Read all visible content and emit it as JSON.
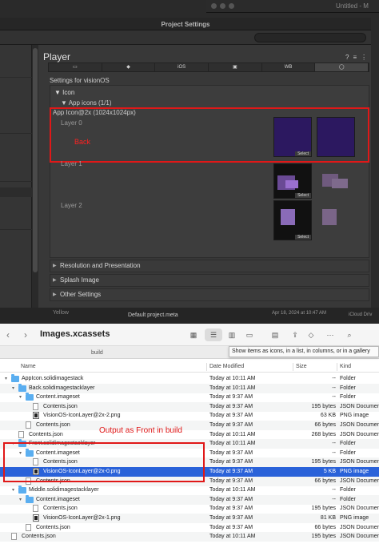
{
  "unity": {
    "bg_window_title": "Untitled - M",
    "window_title": "Project Settings",
    "panel_title": "Player",
    "platform_tabs": [
      "",
      "",
      "iOS",
      "",
      "WB",
      ""
    ],
    "settings_for": "Settings for visionOS",
    "icon_section": "Icon",
    "app_icons": "App icons (1/1)",
    "app_icon_size": "App Icon@2x (1024x1024px)",
    "layers": [
      "Layer 0",
      "Layer 1",
      "Layer 2"
    ],
    "select_label": "Select",
    "back_annotation": "Back",
    "sections": [
      "Resolution and Presentation",
      "Splash Image",
      "Other Settings"
    ],
    "bg_strip": {
      "left": "Yellow",
      "middle": "Default project.meta",
      "date": "Apr 18, 2024 at 10:47 AM",
      "right": "iCloud Driv"
    }
  },
  "finder": {
    "title": "Images.xcassets",
    "path": "build",
    "tooltip": "Show items as icons, in a list, in columns, or in a gallery",
    "columns": {
      "name": "Name",
      "date": "Date Modified",
      "size": "Size",
      "kind": "Kind"
    },
    "annotation": "Output as Front in build",
    "rows": [
      {
        "name": "AppIcon.solidimagestack",
        "date": "Today at 10:11 AM",
        "size": "--",
        "kind": "Folder"
      },
      {
        "name": "Back.solidimagestacklayer",
        "date": "Today at 10:11 AM",
        "size": "--",
        "kind": "Folder"
      },
      {
        "name": "Content.imageset",
        "date": "Today at 9:37 AM",
        "size": "--",
        "kind": "Folder"
      },
      {
        "name": "Contents.json",
        "date": "Today at 9:37 AM",
        "size": "195 bytes",
        "kind": "JSON Document"
      },
      {
        "name": "VisionOS-IconLayer@2x-2.png",
        "date": "Today at 9:37 AM",
        "size": "63 KB",
        "kind": "PNG image"
      },
      {
        "name": "Contents.json",
        "date": "Today at 9:37 AM",
        "size": "66 bytes",
        "kind": "JSON Document"
      },
      {
        "name": "Contents.json",
        "date": "Today at 10:11 AM",
        "size": "268 bytes",
        "kind": "JSON Document"
      },
      {
        "name": "Front.solidimagestacklayer",
        "date": "Today at 10:11 AM",
        "size": "--",
        "kind": "Folder"
      },
      {
        "name": "Content.imageset",
        "date": "Today at 9:37 AM",
        "size": "--",
        "kind": "Folder"
      },
      {
        "name": "Contents.json",
        "date": "Today at 9:37 AM",
        "size": "195 bytes",
        "kind": "JSON Document"
      },
      {
        "name": "VisionOS-IconLayer@2x-0.png",
        "date": "Today at 9:37 AM",
        "size": "5 KB",
        "kind": "PNG image"
      },
      {
        "name": "Contents.json",
        "date": "Today at 9:37 AM",
        "size": "66 bytes",
        "kind": "JSON Document"
      },
      {
        "name": "Middle.solidimagestacklayer",
        "date": "Today at 10:11 AM",
        "size": "--",
        "kind": "Folder"
      },
      {
        "name": "Content.imageset",
        "date": "Today at 9:37 AM",
        "size": "--",
        "kind": "Folder"
      },
      {
        "name": "Contents.json",
        "date": "Today at 9:37 AM",
        "size": "195 bytes",
        "kind": "JSON Document"
      },
      {
        "name": "VisionOS-IconLayer@2x-1.png",
        "date": "Today at 9:37 AM",
        "size": "81 KB",
        "kind": "PNG image"
      },
      {
        "name": "Contents.json",
        "date": "Today at 9:37 AM",
        "size": "66 bytes",
        "kind": "JSON Document"
      },
      {
        "name": "Contents.json",
        "date": "Today at 10:11 AM",
        "size": "195 bytes",
        "kind": "JSON Document"
      }
    ]
  }
}
